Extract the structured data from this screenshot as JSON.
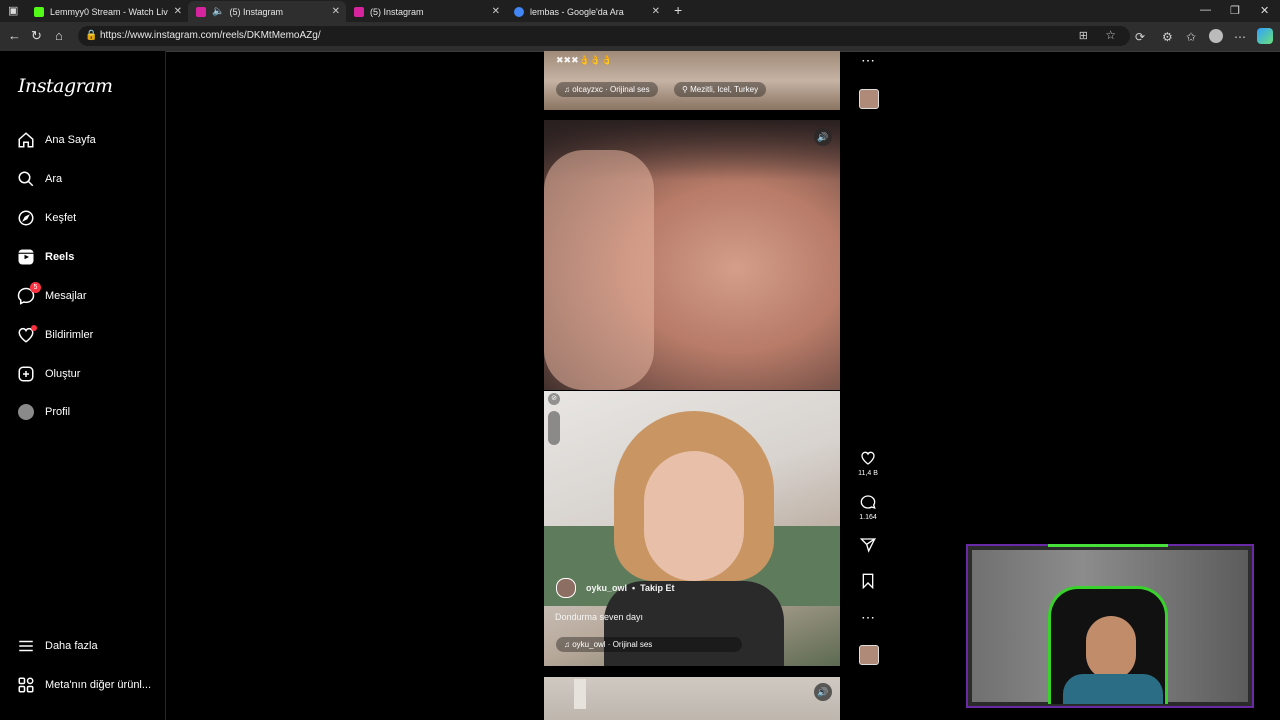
{
  "browser": {
    "tabs": [
      {
        "label": "Lemmyy0 Stream - Watch Live on",
        "favicon_color": "#53fc18",
        "active": false
      },
      {
        "label": "(5) Instagram",
        "favicon_color": "#d6249f",
        "active": true
      },
      {
        "label": "(5) Instagram",
        "favicon_color": "#d6249f",
        "active": false
      },
      {
        "label": "lembas - Google'da Ara",
        "favicon_color": "#4285f4",
        "active": false
      }
    ],
    "url": "https://www.instagram.com/reels/DKMtMemoAZg/"
  },
  "sidebar": {
    "logo": "Instagram",
    "items": [
      {
        "label": "Ana Sayfa",
        "icon": "home-icon"
      },
      {
        "label": "Ara",
        "icon": "search-icon"
      },
      {
        "label": "Keşfet",
        "icon": "compass-icon"
      },
      {
        "label": "Reels",
        "icon": "reels-icon"
      },
      {
        "label": "Mesajlar",
        "icon": "messenger-icon",
        "badge": "5"
      },
      {
        "label": "Bildirimler",
        "icon": "heart-icon"
      },
      {
        "label": "Oluştur",
        "icon": "plus-square-icon"
      },
      {
        "label": "Profil",
        "icon": "avatar"
      }
    ],
    "more": "Daha fazla",
    "meta": "Meta'nın diğer ürünl..."
  },
  "reels": {
    "top": {
      "caption": "✖✖✖👌👌👌",
      "audio": "olcayzxc · Orijinal ses",
      "location": "Mezitli, Icel, Turkey"
    },
    "current": {
      "username": "oyku_owl",
      "separator": "•",
      "follow": "Takip Et",
      "caption": "Dondurma seven dayı",
      "audio": "oyku_owl · Orijinal ses",
      "likes": "11,4 B",
      "comments": "1.164"
    }
  },
  "colors": {
    "accent_red": "#ff3040",
    "webcam_border": "#6a2aa8",
    "webcam_green": "#39d12c"
  }
}
